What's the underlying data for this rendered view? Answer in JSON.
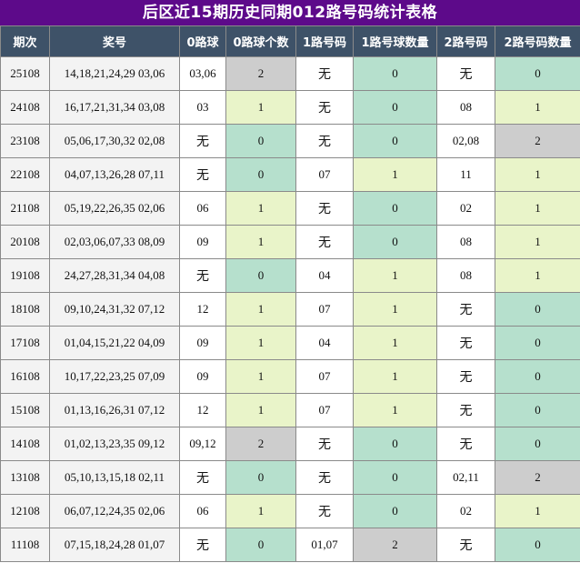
{
  "title": "后区近15期历史同期012路号码统计表格",
  "columns": [
    "期次",
    "奖号",
    "0路球",
    "0路球个数",
    "1路号码",
    "1路号球数量",
    "2路号码",
    "2路号码数量"
  ],
  "colors": {
    "title_bg": "#5d0a8a",
    "header_bg": "#3e5268",
    "count0": "#b6e0cd",
    "count1": "#e9f4c9",
    "count2": "#cdcdcd"
  },
  "rows": [
    {
      "period": "25108",
      "draw": "14,18,21,24,29 03,06",
      "r0": "03,06",
      "c0": "2",
      "r1": "无",
      "c1": "0",
      "r2": "无",
      "c2": "0"
    },
    {
      "period": "24108",
      "draw": "16,17,21,31,34 03,08",
      "r0": "03",
      "c0": "1",
      "r1": "无",
      "c1": "0",
      "r2": "08",
      "c2": "1"
    },
    {
      "period": "23108",
      "draw": "05,06,17,30,32 02,08",
      "r0": "无",
      "c0": "0",
      "r1": "无",
      "c1": "0",
      "r2": "02,08",
      "c2": "2"
    },
    {
      "period": "22108",
      "draw": "04,07,13,26,28 07,11",
      "r0": "无",
      "c0": "0",
      "r1": "07",
      "c1": "1",
      "r2": "11",
      "c2": "1"
    },
    {
      "period": "21108",
      "draw": "05,19,22,26,35 02,06",
      "r0": "06",
      "c0": "1",
      "r1": "无",
      "c1": "0",
      "r2": "02",
      "c2": "1"
    },
    {
      "period": "20108",
      "draw": "02,03,06,07,33 08,09",
      "r0": "09",
      "c0": "1",
      "r1": "无",
      "c1": "0",
      "r2": "08",
      "c2": "1"
    },
    {
      "period": "19108",
      "draw": "24,27,28,31,34 04,08",
      "r0": "无",
      "c0": "0",
      "r1": "04",
      "c1": "1",
      "r2": "08",
      "c2": "1"
    },
    {
      "period": "18108",
      "draw": "09,10,24,31,32 07,12",
      "r0": "12",
      "c0": "1",
      "r1": "07",
      "c1": "1",
      "r2": "无",
      "c2": "0"
    },
    {
      "period": "17108",
      "draw": "01,04,15,21,22 04,09",
      "r0": "09",
      "c0": "1",
      "r1": "04",
      "c1": "1",
      "r2": "无",
      "c2": "0"
    },
    {
      "period": "16108",
      "draw": "10,17,22,23,25 07,09",
      "r0": "09",
      "c0": "1",
      "r1": "07",
      "c1": "1",
      "r2": "无",
      "c2": "0"
    },
    {
      "period": "15108",
      "draw": "01,13,16,26,31 07,12",
      "r0": "12",
      "c0": "1",
      "r1": "07",
      "c1": "1",
      "r2": "无",
      "c2": "0"
    },
    {
      "period": "14108",
      "draw": "01,02,13,23,35 09,12",
      "r0": "09,12",
      "c0": "2",
      "r1": "无",
      "c1": "0",
      "r2": "无",
      "c2": "0"
    },
    {
      "period": "13108",
      "draw": "05,10,13,15,18 02,11",
      "r0": "无",
      "c0": "0",
      "r1": "无",
      "c1": "0",
      "r2": "02,11",
      "c2": "2"
    },
    {
      "period": "12108",
      "draw": "06,07,12,24,35 02,06",
      "r0": "06",
      "c0": "1",
      "r1": "无",
      "c1": "0",
      "r2": "02",
      "c2": "1"
    },
    {
      "period": "11108",
      "draw": "07,15,18,24,28 01,07",
      "r0": "无",
      "c0": "0",
      "r1": "01,07",
      "c1": "2",
      "r2": "无",
      "c2": "0"
    }
  ]
}
